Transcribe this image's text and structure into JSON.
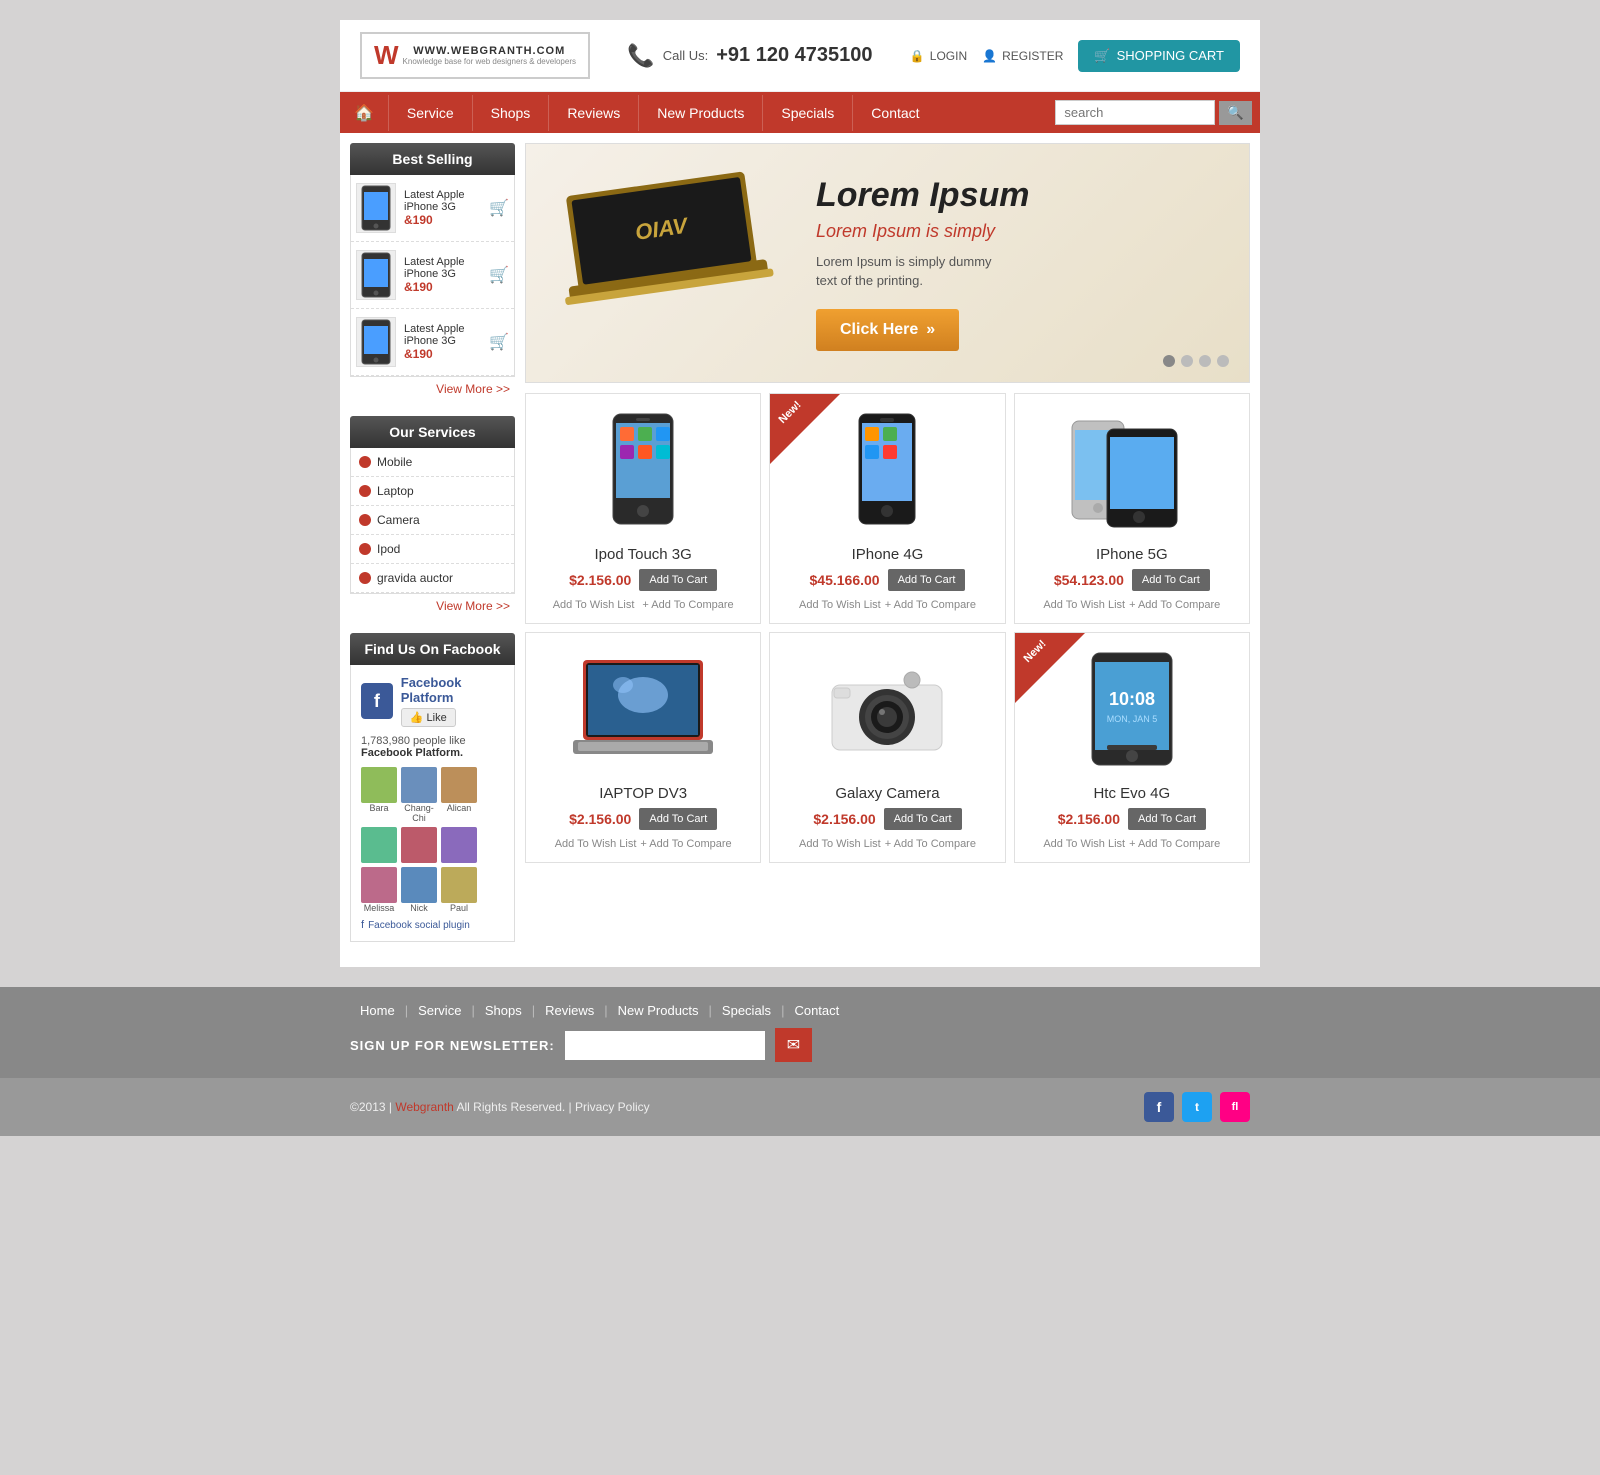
{
  "site": {
    "logo_w": "W",
    "logo_name": "WWW.WEBGRANTH.COM",
    "logo_sub": "Knowledge base for web designers & developers"
  },
  "header": {
    "call_label": "Call Us:",
    "phone": "+91 120 4735100",
    "login": "LOGIN",
    "register": "REGISTER",
    "cart": "SHOPPING CART"
  },
  "nav": {
    "home_icon": "🏠",
    "items": [
      "Service",
      "Shops",
      "Reviews",
      "New Products",
      "Specials",
      "Contact"
    ],
    "search_placeholder": "search"
  },
  "sidebar": {
    "best_selling_title": "Best Selling",
    "items": [
      {
        "name": "Latest Apple iPhone 3G",
        "price": "&190"
      },
      {
        "name": "Latest Apple iPhone 3G",
        "price": "&190"
      },
      {
        "name": "Latest Apple iPhone 3G",
        "price": "&190"
      }
    ],
    "view_more": "View More >>",
    "services_title": "Our Services",
    "service_items": [
      "Mobile",
      "Laptop",
      "Camera",
      "Ipod",
      "gravida auctor"
    ],
    "services_view_more": "View More >>",
    "facebook_title": "Find Us On Facbook",
    "fb_name": "Facebook Platform",
    "fb_like": "👍 Like",
    "fb_likes_count": "1,783,980",
    "fb_likes_text": "people like",
    "fb_likes_bold": "Facebook Platform.",
    "fb_people": [
      {
        "name": "Bara"
      },
      {
        "name": "Chang-Chi"
      },
      {
        "name": "Alican"
      },
      {
        "name": ""
      },
      {
        "name": ""
      },
      {
        "name": ""
      },
      {
        "name": "Melissa"
      },
      {
        "name": "Nick"
      },
      {
        "name": "Paul"
      }
    ],
    "fb_plugin": "Facebook social plugin"
  },
  "hero": {
    "logo_text": "OIAV",
    "title": "Lorem Ipsum",
    "subtitle": "Lorem Ipsum is simply",
    "description": "Lorem Ipsum is simply dummy\ntext of the printing.",
    "button": "Click Here",
    "button_icon": "»"
  },
  "products": [
    {
      "name": "Ipod Touch 3G",
      "price": "$2.156.00",
      "add_cart": "Add To Cart",
      "wish": "Add To Wish List",
      "compare": "+ Add To Compare",
      "new": false,
      "type": "phone"
    },
    {
      "name": "IPhone 4G",
      "price": "$45.166.00",
      "add_cart": "Add To Cart",
      "wish": "Add To Wish List",
      "compare": "+ Add To Compare",
      "new": true,
      "type": "iphone"
    },
    {
      "name": "IPhone 5G",
      "price": "$54.123.00",
      "add_cart": "Add To Cart",
      "wish": "Add To Wish List",
      "compare": "+ Add To Compare",
      "new": false,
      "type": "iphone5"
    },
    {
      "name": "IAPTOP DV3",
      "price": "$2.156.00",
      "add_cart": "Add To Cart",
      "wish": "Add To Wish List",
      "compare": "+ Add To Compare",
      "new": false,
      "type": "laptop"
    },
    {
      "name": "Galaxy Camera",
      "price": "$2.156.00",
      "add_cart": "Add To Cart",
      "wish": "Add To Wish List",
      "compare": "+ Add To Compare",
      "new": false,
      "type": "camera"
    },
    {
      "name": "Htc Evo 4G",
      "price": "$2.156.00",
      "add_cart": "Add To Cart",
      "wish": "Add To Wish List",
      "compare": "+ Add To Compare",
      "new": true,
      "type": "htc"
    }
  ],
  "footer": {
    "links": [
      "Home",
      "Service",
      "Shops",
      "Reviews",
      "New Products",
      "Specials",
      "Contact"
    ],
    "newsletter_label": "SIGN UP FOR NEWSLETTER:",
    "newsletter_placeholder": "",
    "copyright": "©2013 |",
    "brand": "Webgranth",
    "rights": "All Rights Reserved. | Privacy Policy"
  }
}
